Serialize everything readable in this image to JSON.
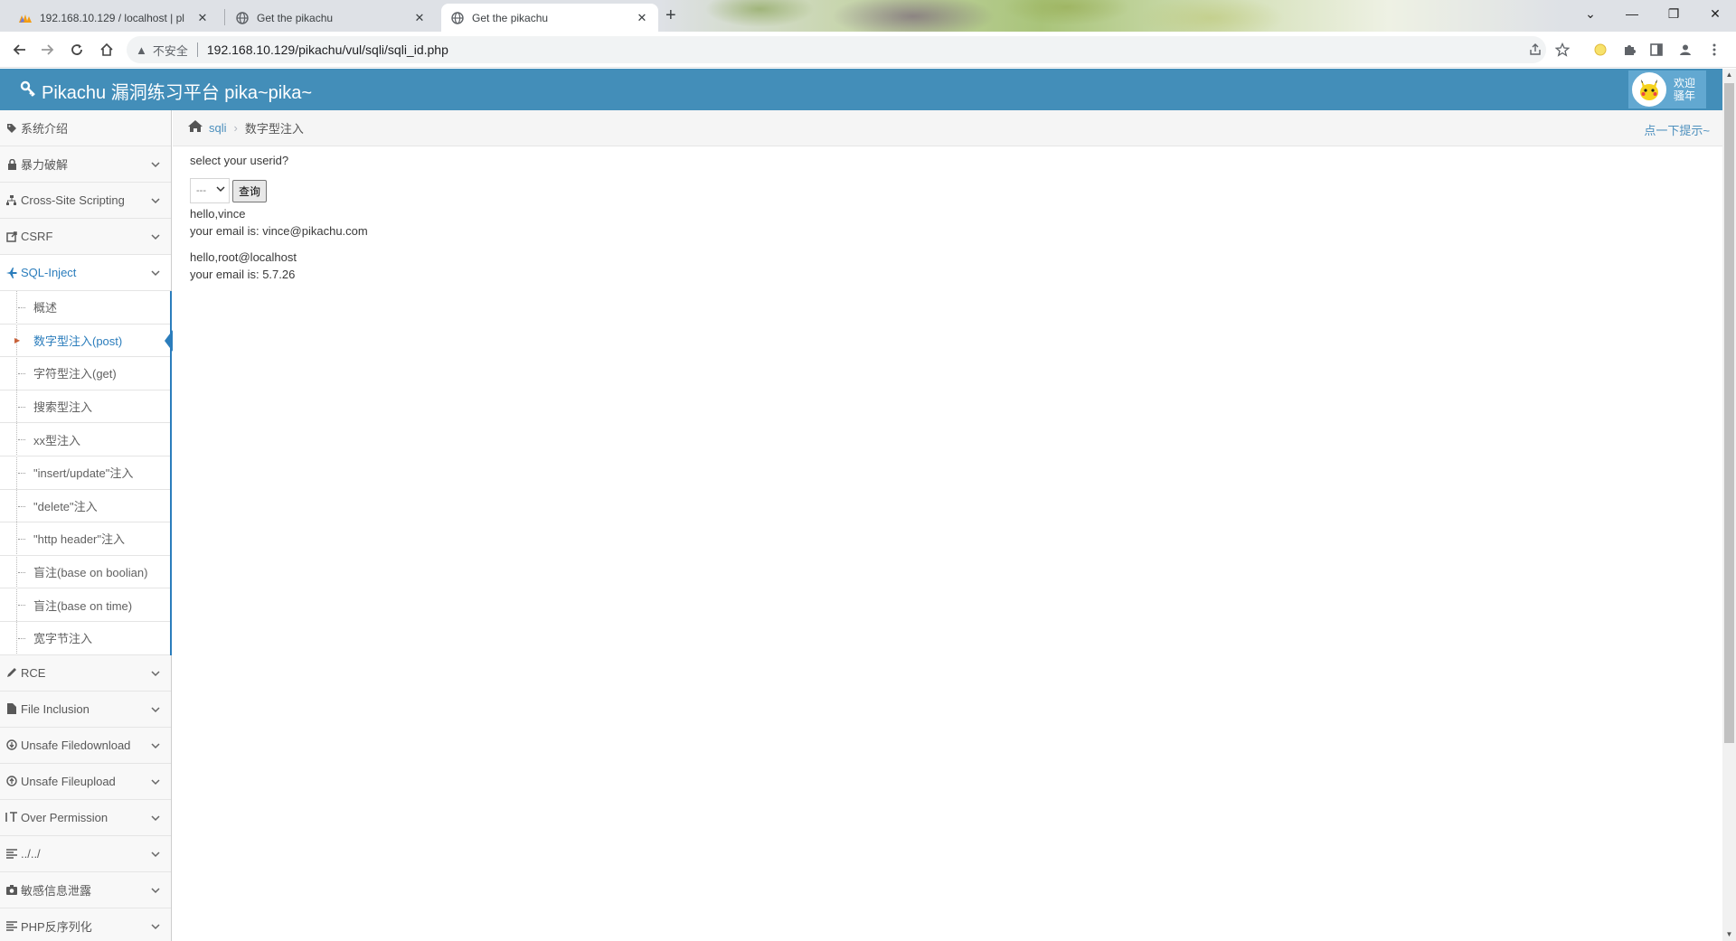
{
  "browser": {
    "tabs": [
      {
        "title": "192.168.10.129 / localhost | pl",
        "active": false
      },
      {
        "title": "Get the pikachu",
        "active": false
      },
      {
        "title": "Get the pikachu",
        "active": true
      }
    ],
    "insecure_label": "不安全",
    "url": "192.168.10.129/pikachu/vul/sqli/sqli_id.php"
  },
  "header": {
    "brand": "Pikachu 漏洞练习平台 pika~pika~",
    "welcome_line1": "欢迎",
    "welcome_line2": "骚年"
  },
  "sidebar": {
    "items_top": [
      {
        "label": "系统介绍",
        "icon": "tag-icon"
      },
      {
        "label": "暴力破解",
        "icon": "lock-icon"
      },
      {
        "label": "Cross-Site Scripting",
        "icon": "sitemap-icon"
      },
      {
        "label": "CSRF",
        "icon": "share-icon"
      },
      {
        "label": "SQL-Inject",
        "icon": "plane-icon"
      }
    ],
    "sql_submenu": [
      "概述",
      "数字型注入(post)",
      "字符型注入(get)",
      "搜索型注入",
      "xx型注入",
      "\"insert/update\"注入",
      "\"delete\"注入",
      "\"http header\"注入",
      "盲注(base on boolian)",
      "盲注(base on time)",
      "宽字节注入"
    ],
    "active_sub": "数字型注入(post)",
    "items_bottom": [
      {
        "label": "RCE",
        "icon": "pencil-icon"
      },
      {
        "label": "File Inclusion",
        "icon": "file-icon"
      },
      {
        "label": "Unsafe Filedownload",
        "icon": "download-icon"
      },
      {
        "label": "Unsafe Fileupload",
        "icon": "upload-icon"
      },
      {
        "label": "Over Permission",
        "icon": "text-height-icon"
      },
      {
        "label": "../../",
        "icon": "align-left-icon"
      },
      {
        "label": "敏感信息泄露",
        "icon": "camera-icon"
      },
      {
        "label": "PHP反序列化",
        "icon": "align-left-icon"
      }
    ]
  },
  "breadcrumb": {
    "link": "sqli",
    "current": "数字型注入",
    "hint": "点一下提示~"
  },
  "main": {
    "prompt": "select your userid?",
    "select_value": "---",
    "query_button": "查询",
    "results": [
      {
        "hello": "hello,vince",
        "email": "your email is: vince@pikachu.com"
      },
      {
        "hello": "hello,root@localhost",
        "email": "your email is: 5.7.26"
      }
    ]
  }
}
